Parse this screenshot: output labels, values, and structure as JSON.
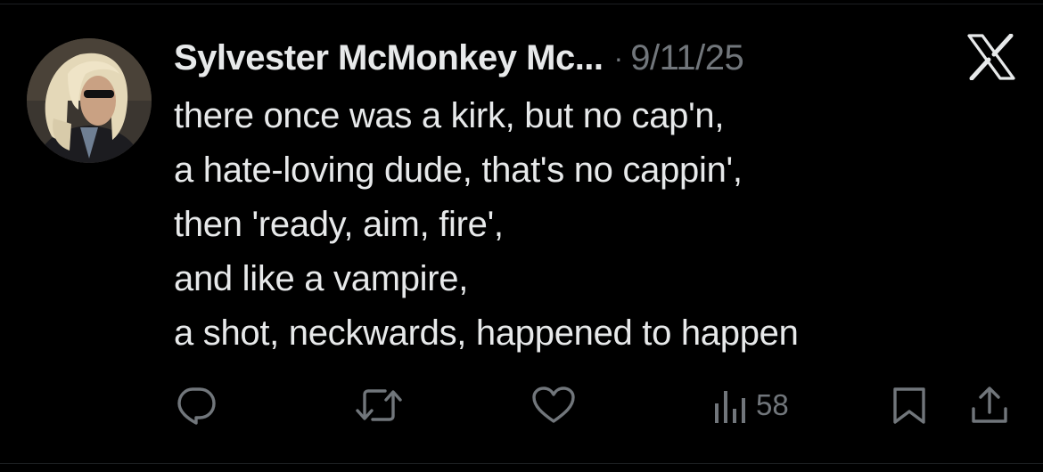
{
  "tweet": {
    "author_name": "Sylvester McMonkey Mc...",
    "separator": "·",
    "date": "9/11/25",
    "lines": [
      "there once was a kirk, but no cap'n,",
      "a hate-loving dude, that's no cappin',",
      "then 'ready, aim, fire',",
      "and like a vampire,",
      "a shot, neckwards, happened to happen"
    ]
  },
  "actions": {
    "reply_icon": "reply-icon",
    "retweet_icon": "retweet-icon",
    "like_icon": "heart-icon",
    "views_icon": "views-icon",
    "views_count": "58",
    "bookmark_icon": "bookmark-icon",
    "share_icon": "share-icon"
  },
  "colors": {
    "background": "#000000",
    "text": "#e7e9ea",
    "secondary_text": "#71767b"
  }
}
